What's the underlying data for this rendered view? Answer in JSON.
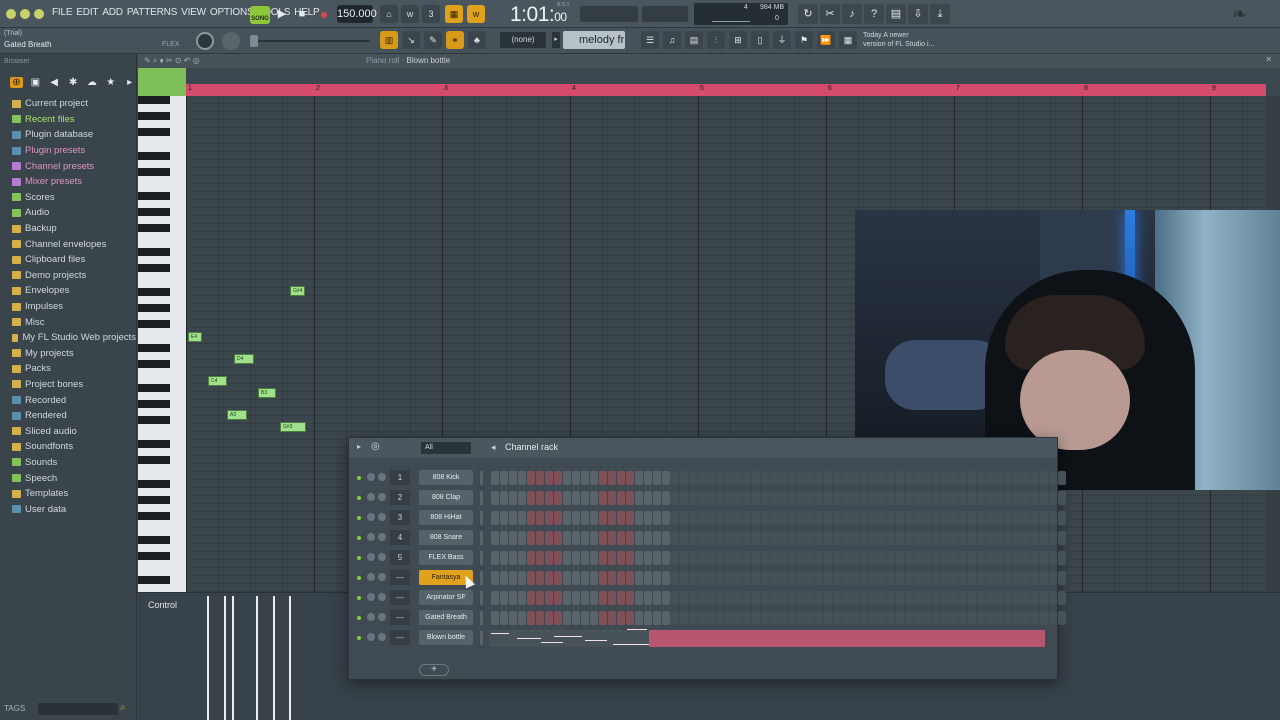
{
  "menu": [
    "FILE",
    "EDIT",
    "ADD",
    "PATTERNS",
    "VIEW",
    "OPTIONS",
    "TOOLS",
    "HELP"
  ],
  "transport": {
    "song_label": "SONG",
    "tempo": "150.000",
    "time": "1:01",
    "time_small": "00",
    "time_sup": "B:S:T"
  },
  "perf": {
    "cpu_top": "4",
    "mem": "984 MB",
    "cpu_bottom": "0"
  },
  "channel": {
    "trial": "(Trial)",
    "name": "Gated Breath",
    "flex": "FLEX"
  },
  "pattern": {
    "none_label": "(none)",
    "name": "melody fr"
  },
  "news": {
    "line1": "Today  A newer",
    "line2": "version of FL Studio i..."
  },
  "browser": {
    "header": "Browser",
    "items": [
      {
        "label": "Current project",
        "icon": "folder-icon"
      },
      {
        "label": "Recent files",
        "icon": "recent-icon"
      },
      {
        "label": "Plugin database",
        "icon": "plugin-icon"
      },
      {
        "label": "Plugin presets",
        "icon": "plugin-icon"
      },
      {
        "label": "Channel presets",
        "icon": "channel-icon"
      },
      {
        "label": "Mixer presets",
        "icon": "mixer-icon"
      },
      {
        "label": "Scores",
        "icon": "score-icon"
      },
      {
        "label": "Audio",
        "icon": "audio-icon"
      },
      {
        "label": "Backup",
        "icon": "folder-icon"
      },
      {
        "label": "Channel envelopes",
        "icon": "folder-icon"
      },
      {
        "label": "Clipboard files",
        "icon": "folder-icon"
      },
      {
        "label": "Demo projects",
        "icon": "folder-icon"
      },
      {
        "label": "Envelopes",
        "icon": "folder-icon"
      },
      {
        "label": "Impulses",
        "icon": "folder-icon"
      },
      {
        "label": "Misc",
        "icon": "folder-icon"
      },
      {
        "label": "My FL Studio Web projects",
        "icon": "folder-icon"
      },
      {
        "label": "My projects",
        "icon": "folder-icon"
      },
      {
        "label": "Packs",
        "icon": "folder-icon"
      },
      {
        "label": "Project bones",
        "icon": "folder-icon"
      },
      {
        "label": "Recorded",
        "icon": "plus-icon"
      },
      {
        "label": "Rendered",
        "icon": "plus-icon"
      },
      {
        "label": "Sliced audio",
        "icon": "folder-icon"
      },
      {
        "label": "Soundfonts",
        "icon": "folder-icon"
      },
      {
        "label": "Sounds",
        "icon": "sounds-icon"
      },
      {
        "label": "Speech",
        "icon": "speech-icon"
      },
      {
        "label": "Templates",
        "icon": "folder-icon"
      },
      {
        "label": "User data",
        "icon": "user-icon"
      }
    ],
    "tags_label": "TAGS"
  },
  "piano_roll": {
    "title_prefix": "Piano roll",
    "title_sep": "·",
    "title_channel": "Blown bottle",
    "bars": [
      "1",
      "2",
      "3",
      "4",
      "5",
      "6",
      "7",
      "8",
      "9"
    ],
    "notes": [
      {
        "label": "G#4"
      },
      {
        "label": "E4"
      },
      {
        "label": "D4"
      },
      {
        "label": "C4"
      },
      {
        "label": "B3"
      },
      {
        "label": "A3"
      },
      {
        "label": "G#3"
      }
    ]
  },
  "control": {
    "label": "Control"
  },
  "channel_rack": {
    "filter": "All",
    "title": "Channel rack",
    "channels": [
      {
        "num": "1",
        "name": "808 Kick"
      },
      {
        "num": "2",
        "name": "808 Clap"
      },
      {
        "num": "3",
        "name": "808 HiHat"
      },
      {
        "num": "4",
        "name": "808 Snare"
      },
      {
        "num": "5",
        "name": "FLEX Bass"
      },
      {
        "num": "---",
        "name": "Fantasya"
      },
      {
        "num": "---",
        "name": "Arpinator SF"
      },
      {
        "num": "---",
        "name": "Gated Breath"
      },
      {
        "num": "---",
        "name": "Blown bottle"
      }
    ],
    "selected_index": 5,
    "add_label": "+"
  },
  "colors": {
    "accent": "#e0a21c",
    "ruler": "#d44b6b",
    "note": "#9fe08a",
    "led": "#8ed03c"
  }
}
